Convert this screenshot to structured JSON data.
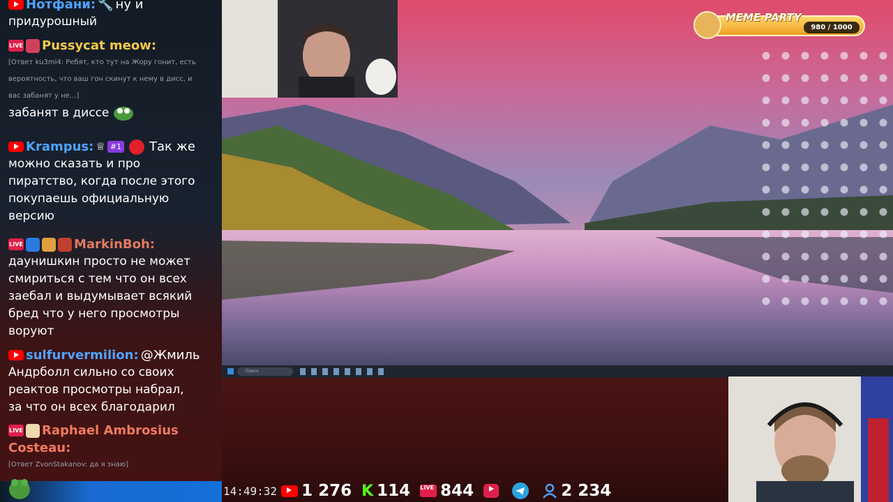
{
  "chat": {
    "messages": [
      {
        "author": "Нотфани:",
        "author_color": "#4fa3ff",
        "lines": [
          "ну и",
          "придурошный"
        ]
      },
      {
        "author": "Pussycat meow:",
        "author_color": "#f7c948",
        "reply": [
          "[Ответ ku3mi4: Ребят, кто тут на Жору гонит, есть",
          "вероятность, что ваш гон скинут к нему в дисс, и",
          "вас забанят у не...]"
        ],
        "lines": [
          "забанят в диссе"
        ]
      },
      {
        "author": "Krampus:",
        "author_color": "#4fa3ff",
        "rank_badge": "#1",
        "lines": [
          "Так же",
          "можно сказать и про",
          "пиратство, когда после этого",
          "покупаешь официальную",
          "версию"
        ]
      },
      {
        "author": "MarkinBoh:",
        "author_color": "#e07a5f",
        "lines": [
          "даунишкин просто не может",
          "смириться с тем что он всех",
          "заебал и выдумывает всякий",
          "бред что у него просмотры",
          "воруют"
        ]
      },
      {
        "author": "sulfurvermilion:",
        "author_color": "#4fa3ff",
        "mention": "@Жмиль",
        "lines": [
          "Андрболл сильно со своих",
          "реактов просмотры набрал,",
          "за что он всех благодарил"
        ]
      },
      {
        "author": "Raphael Ambrosius",
        "author_line2": "Costeau:",
        "author_color": "#f07a5f",
        "reply": [
          "[Ответ ZvonStakanov: да я знаю]"
        ]
      }
    ]
  },
  "stats": {
    "time": "14:49:32",
    "youtube": "1 276",
    "kick": "114",
    "vk": "844",
    "viewers": "2 234"
  },
  "meme_party": {
    "title": "MEME PARTY",
    "count": "980 / 1000"
  },
  "taskbar": {
    "search_placeholder": "Поиск"
  },
  "colors": {
    "youtube": "#ff0000",
    "kick": "#53fc18",
    "vk_live": "#e0204a",
    "telegram": "#2aa3e0",
    "accent_blue": "#1a6ad0"
  }
}
